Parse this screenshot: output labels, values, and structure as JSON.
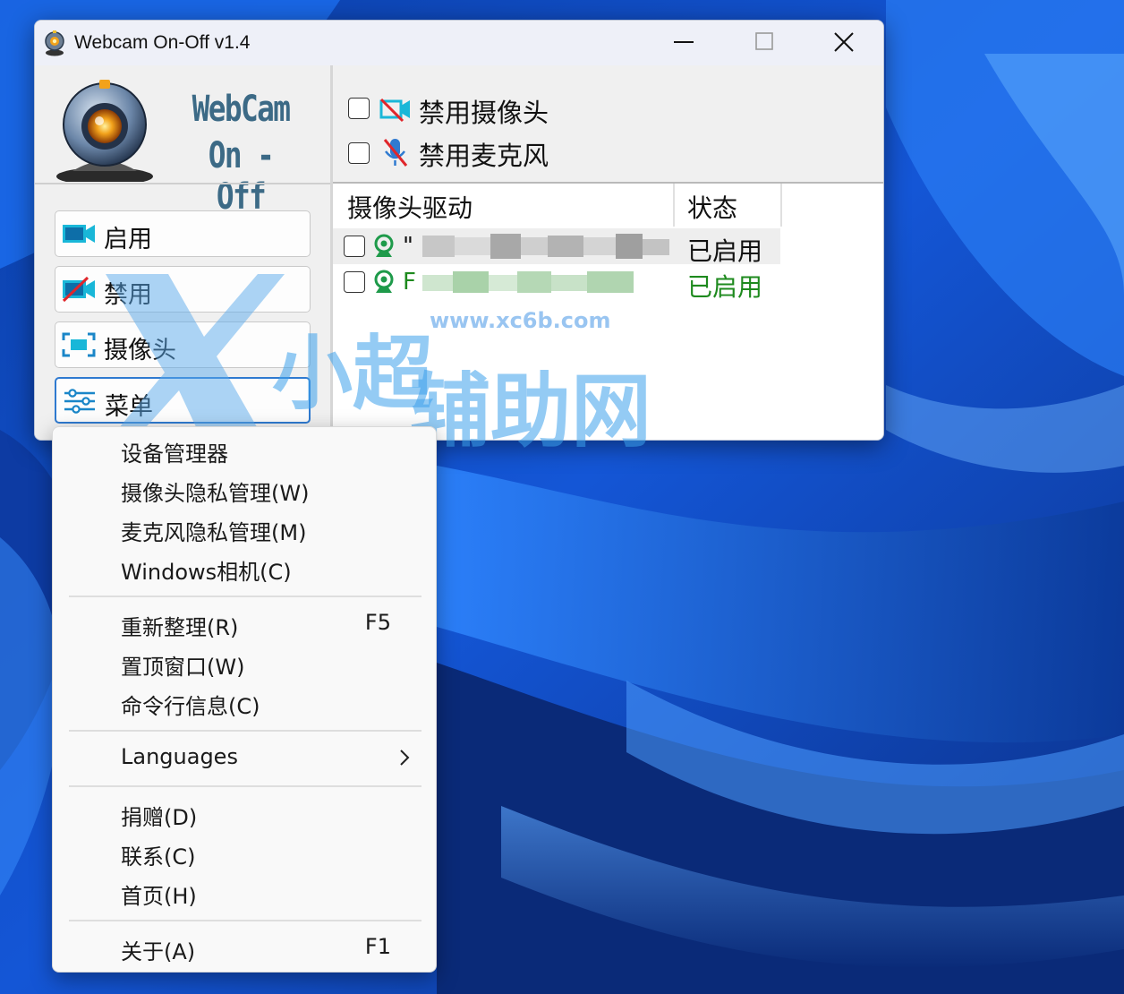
{
  "window": {
    "title": "Webcam On-Off v1.4",
    "logo_line1": "WebCam",
    "logo_line2": "On - Off"
  },
  "sidebar": {
    "buttons": [
      {
        "label": "启用",
        "icon": "camera-enable-icon"
      },
      {
        "label": "禁用",
        "icon": "camera-disable-icon"
      },
      {
        "label": "摄像头",
        "icon": "camera-frame-icon"
      },
      {
        "label": "菜单",
        "icon": "menu-sliders-icon"
      }
    ]
  },
  "options": {
    "disable_camera": "禁用摄像头",
    "disable_mic": "禁用麦克风"
  },
  "device_list": {
    "columns": [
      "摄像头驱动",
      "状态"
    ],
    "rows": [
      {
        "name": "\"",
        "status": "已启用"
      },
      {
        "name": "F",
        "status": "已启用"
      }
    ]
  },
  "menu": {
    "items": [
      {
        "label": "设备管理器",
        "shortcut": ""
      },
      {
        "label": "摄像头隐私管理(W)",
        "shortcut": ""
      },
      {
        "label": "麦克风隐私管理(M)",
        "shortcut": ""
      },
      {
        "label": "Windows相机(C)",
        "shortcut": ""
      },
      {
        "label": "重新整理(R)",
        "shortcut": "F5"
      },
      {
        "label": "置顶窗口(W)",
        "shortcut": ""
      },
      {
        "label": "命令行信息(C)",
        "shortcut": ""
      },
      {
        "label": "Languages",
        "shortcut": ""
      },
      {
        "label": "捐赠(D)",
        "shortcut": ""
      },
      {
        "label": "联系(C)",
        "shortcut": ""
      },
      {
        "label": "首页(H)",
        "shortcut": ""
      },
      {
        "label": "关于(A)",
        "shortcut": "F1"
      }
    ]
  },
  "watermark": {
    "url": "www.xc6b.com",
    "text1": "小超",
    "text2": "辅助网"
  },
  "colors": {
    "accent": "#2f7ad0",
    "enabled_green": "#1e8a1e",
    "icon_cyan": "#19b7d8"
  }
}
